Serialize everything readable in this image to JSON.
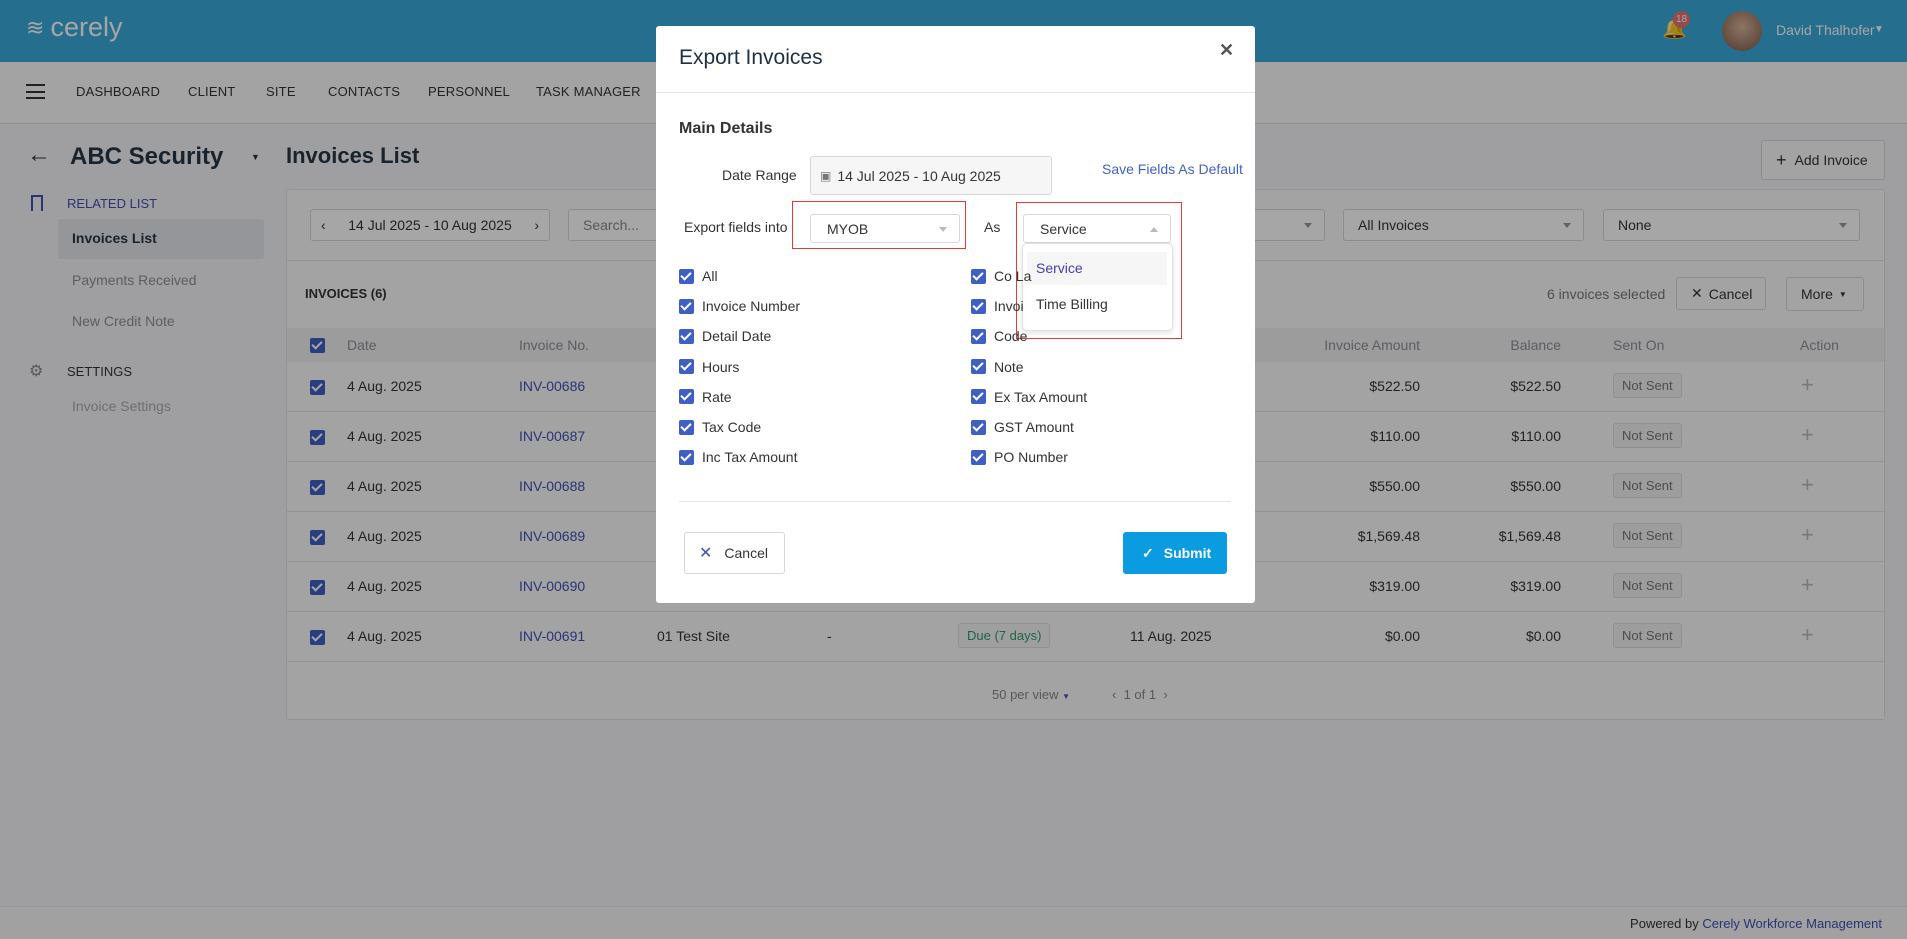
{
  "app": {
    "brand": "cerely",
    "notification_count": "18",
    "user_name": "David Thalhofer"
  },
  "nav": [
    "DASHBOARD",
    "CLIENT",
    "SITE",
    "CONTACTS",
    "PERSONNEL",
    "TASK MANAGER"
  ],
  "sidebar": {
    "title": "ABC Security",
    "related_heading": "RELATED LIST",
    "items": [
      "Invoices List",
      "Payments Received",
      "New Credit Note"
    ],
    "settings_heading": "SETTINGS",
    "settings_items": [
      "Invoice Settings"
    ]
  },
  "page": {
    "title": "Invoices List",
    "add_button": "Add Invoice"
  },
  "filters": {
    "date_range": "14 Jul 2025 - 10 Aug 2025",
    "search_placeholder": "Search...",
    "status": "All Invoices",
    "group": "None"
  },
  "list": {
    "heading": "INVOICES (6)",
    "selected_text": "6 invoices selected",
    "cancel": "Cancel",
    "more": "More"
  },
  "table": {
    "headers": [
      "Date",
      "Invoice No.",
      "Invoice Amount",
      "Balance",
      "Sent On",
      "Action"
    ],
    "rows": [
      {
        "date": "4 Aug. 2025",
        "no": "INV-00686",
        "amount": "$522.50",
        "balance": "$522.50",
        "sent": "Not Sent"
      },
      {
        "date": "4 Aug. 2025",
        "no": "INV-00687",
        "amount": "$110.00",
        "balance": "$110.00",
        "sent": "Not Sent"
      },
      {
        "date": "4 Aug. 2025",
        "no": "INV-00688",
        "amount": "$550.00",
        "balance": "$550.00",
        "sent": "Not Sent"
      },
      {
        "date": "4 Aug. 2025",
        "no": "INV-00689",
        "amount": "$1,569.48",
        "balance": "$1,569.48",
        "sent": "Not Sent"
      },
      {
        "date": "4 Aug. 2025",
        "no": "INV-00690",
        "amount": "$319.00",
        "balance": "$319.00",
        "sent": "Not Sent"
      },
      {
        "date": "4 Aug. 2025",
        "no": "INV-00691",
        "site": "01 Test Site",
        "contact": "-",
        "status": "Due (7 days)",
        "due": "11 Aug. 2025",
        "amount": "$0.00",
        "balance": "$0.00",
        "sent": "Not Sent"
      }
    ]
  },
  "pagination": {
    "per_view": "50 per view",
    "page": "1 of 1"
  },
  "footer": {
    "prefix": "Powered by",
    "link": "Cerely Workforce Management"
  },
  "modal": {
    "title": "Export Invoices",
    "section": "Main Details",
    "date_label": "Date Range",
    "date_value": "14 Jul 2025 - 10 Aug 2025",
    "save_default": "Save Fields As Default",
    "export_label": "Export fields into",
    "export_value": "MYOB",
    "as_label": "As",
    "as_value": "Service",
    "as_options": [
      "Service",
      "Time Billing"
    ],
    "fields_left": [
      "All",
      "Invoice Number",
      "Detail Date",
      "Hours",
      "Rate",
      "Tax Code",
      "Inc Tax Amount"
    ],
    "fields_right": [
      "Co La",
      "Invoi",
      "Code",
      "Note",
      "Ex Tax Amount",
      "GST Amount",
      "PO Number"
    ],
    "cancel": "Cancel",
    "submit": "Submit"
  }
}
